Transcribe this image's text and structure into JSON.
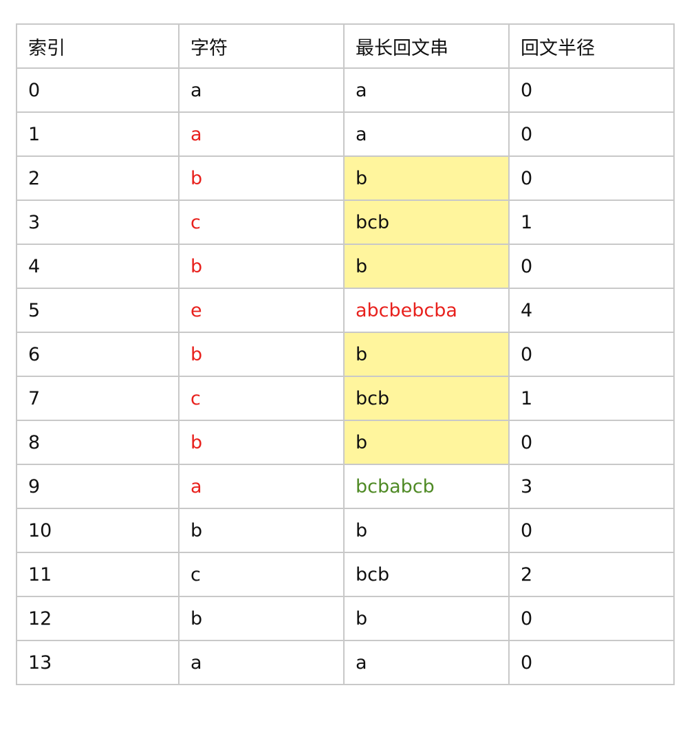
{
  "table": {
    "headers": [
      "索引",
      "字符",
      "最长回文串",
      "回文半径"
    ],
    "rows": [
      {
        "index": "0",
        "char": "a",
        "palindrome": "a",
        "radius": "0"
      },
      {
        "index": "1",
        "char": "a",
        "palindrome": "a",
        "radius": "0"
      },
      {
        "index": "2",
        "char": "b",
        "palindrome": "b",
        "radius": "0"
      },
      {
        "index": "3",
        "char": "c",
        "palindrome": "bcb",
        "radius": "1"
      },
      {
        "index": "4",
        "char": "b",
        "palindrome": "b",
        "radius": "0"
      },
      {
        "index": "5",
        "char": "e",
        "palindrome": "abcbebcba",
        "radius": "4"
      },
      {
        "index": "6",
        "char": "b",
        "palindrome": "b",
        "radius": "0"
      },
      {
        "index": "7",
        "char": "c",
        "palindrome": "bcb",
        "radius": "1"
      },
      {
        "index": "8",
        "char": "b",
        "palindrome": "b",
        "radius": "0"
      },
      {
        "index": "9",
        "char": "a",
        "palindrome": "bcbabcb",
        "radius": "3"
      },
      {
        "index": "10",
        "char": "b",
        "palindrome": "b",
        "radius": "0"
      },
      {
        "index": "11",
        "char": "c",
        "palindrome": "bcb",
        "radius": "2"
      },
      {
        "index": "12",
        "char": "b",
        "palindrome": "b",
        "radius": "0"
      },
      {
        "index": "13",
        "char": "a",
        "palindrome": "a",
        "radius": "0"
      }
    ]
  },
  "colors": {
    "text": "#111111",
    "highlight_text": "#e8211d",
    "secondary_text": "#4f8a25",
    "highlight_fill": "#fff59d",
    "border": "#c8c8c8"
  }
}
